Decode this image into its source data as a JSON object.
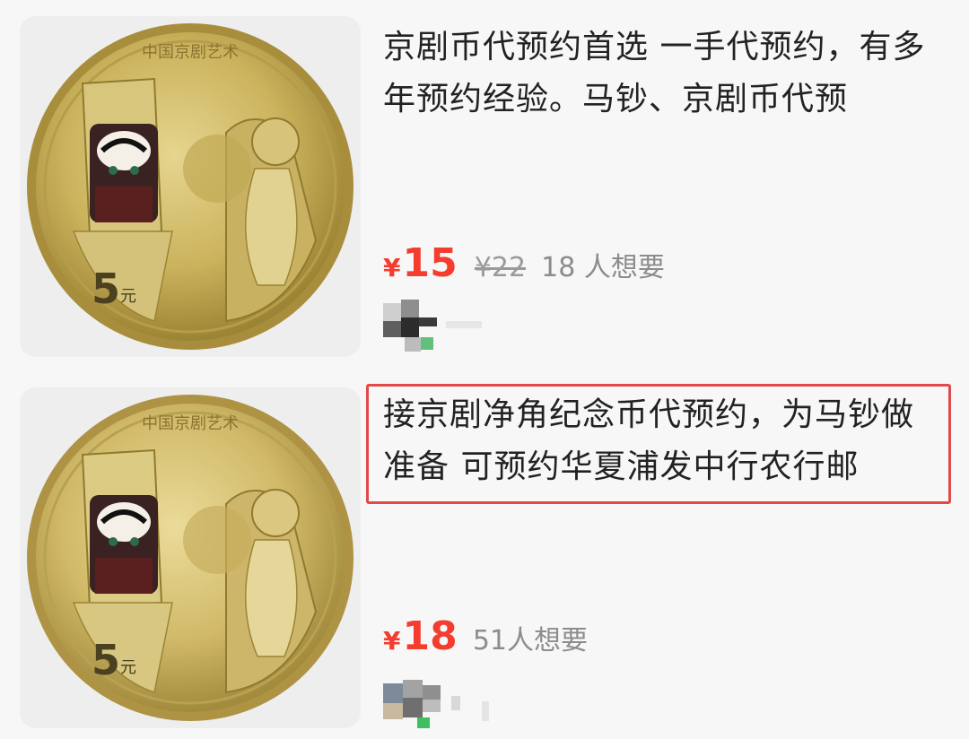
{
  "listings": [
    {
      "title": "京剧币代预约首选 一手代预约，有多年预约经验。马钞、京剧币代预",
      "currency": "¥",
      "price": "15",
      "original_price": "¥22",
      "wants": "18 人想要",
      "image_icon": "coin-image",
      "coin_text_top": "中国京剧艺术",
      "coin_denomination": "5",
      "coin_unit": "元",
      "highlighted": false
    },
    {
      "title": "接京剧净角纪念币代预约，为马钞做准备 可预约华夏浦发中行农行邮",
      "currency": "¥",
      "price": "18",
      "wants": "51人想要",
      "image_icon": "coin-image",
      "coin_text_top": "中国京剧艺术",
      "coin_denomination": "5",
      "coin_unit": "元",
      "highlighted": true,
      "highlight_color": "#e14a4a"
    }
  ],
  "colors": {
    "price": "#f43c2f",
    "background": "#f7f7f7"
  }
}
